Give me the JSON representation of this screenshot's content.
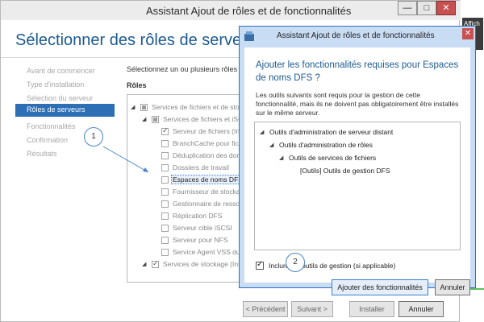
{
  "main_window": {
    "title": "Assistant Ajout de rôles et de fonctionnalités",
    "header": "Sélectionner des rôles de serveurs",
    "controls": {
      "minimize": "—",
      "maximize": "□",
      "close": "✕"
    },
    "nav": [
      "Avant de commencer",
      "Type d'installation",
      "Sélection du serveur",
      "Rôles de serveurs",
      "Fonctionnalités",
      "Confirmation",
      "Résultats"
    ],
    "intro": "Sélectionnez un ou plusieurs rôles à i",
    "roles_label": "Rôles",
    "roles": [
      "Services de fichiers et de stoc",
      "Services de fichiers et iSCSI",
      "Serveur de fichiers (Ins",
      "BranchCache pour fich",
      "Déduplication des don",
      "Dossiers de travail",
      "Espaces de noms DFS",
      "Fournisseur de stockag",
      "Gestionnaire de ressou",
      "Réplication DFS",
      "Serveur cible iSCSI",
      "Serveur pour NFS",
      "Service Agent VSS du",
      "Services de stockage (Inst"
    ],
    "buttons": {
      "previous": "< Précédent",
      "next": "Suivant >",
      "install": "Installer",
      "cancel": "Annuler"
    }
  },
  "callouts": {
    "one": "1",
    "two": "2"
  },
  "dialog": {
    "title": "Assistant Ajout de rôles et de fonctionnalités",
    "close": "✕",
    "heading": "Ajouter les fonctionnalités requises pour Espaces de noms DFS ?",
    "description": "Les outils suivants sont requis pour la gestion de cette fonctionnalité, mais ils ne doivent pas obligatoirement être installés sur le même serveur.",
    "features": [
      "Outils d'administration de serveur distant",
      "Outils d'administration de rôles",
      "Outils de services de fichiers",
      "[Outils] Outils de gestion DFS"
    ],
    "include_label": "Inclure les outils de gestion (si applicable)",
    "add_button": "Ajouter des fonctionnalités",
    "cancel_button": "Annuler"
  },
  "background_window": {
    "label": "Affich"
  }
}
